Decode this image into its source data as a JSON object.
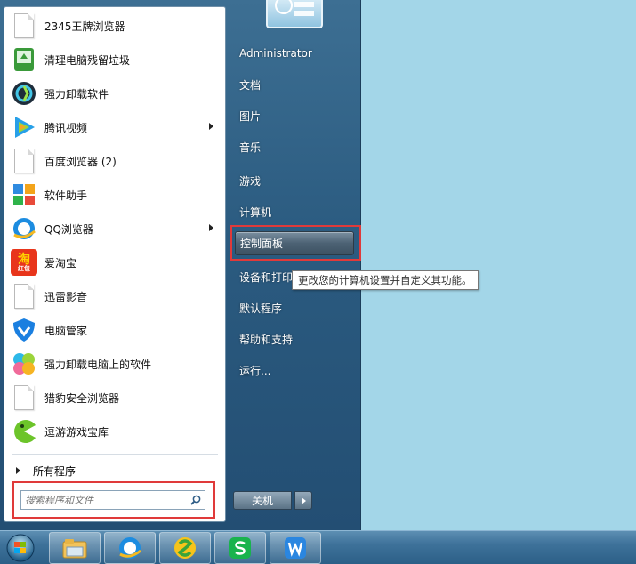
{
  "programs": [
    {
      "label": "2345王牌浏览器",
      "icon": "blank-file-icon",
      "has_submenu": false
    },
    {
      "label": "清理电脑残留垃圾",
      "icon": "recycle-bin-icon",
      "has_submenu": false
    },
    {
      "label": "强力卸载软件",
      "icon": "uninstaller-icon",
      "has_submenu": false
    },
    {
      "label": "腾讯视频",
      "icon": "tencent-video-icon",
      "has_submenu": true
    },
    {
      "label": "百度浏览器 (2)",
      "icon": "blank-file-icon",
      "has_submenu": false
    },
    {
      "label": "软件助手",
      "icon": "app-helper-icon",
      "has_submenu": false
    },
    {
      "label": "QQ浏览器",
      "icon": "qq-browser-icon",
      "has_submenu": true
    },
    {
      "label": "爱淘宝",
      "icon": "taobao-icon",
      "has_submenu": false
    },
    {
      "label": "迅雷影音",
      "icon": "blank-file-icon",
      "has_submenu": false
    },
    {
      "label": "电脑管家",
      "icon": "pc-manager-shield-icon",
      "has_submenu": false
    },
    {
      "label": "强力卸载电脑上的软件",
      "icon": "pinwheel-icon",
      "has_submenu": false
    },
    {
      "label": "猎豹安全浏览器",
      "icon": "blank-file-icon",
      "has_submenu": false
    },
    {
      "label": "逗游游戏宝库",
      "icon": "game-pacman-icon",
      "has_submenu": false
    }
  ],
  "taobao_badge": "淘",
  "taobao_sub": "红包",
  "all_programs_label": "所有程序",
  "search_placeholder": "搜索程序和文件",
  "right_links": {
    "user": "Administrator",
    "documents": "文档",
    "pictures": "图片",
    "music": "音乐",
    "games": "游戏",
    "computer": "计算机",
    "control_panel": "控制面板",
    "devices": "设备和打印",
    "default_programs": "默认程序",
    "help": "帮助和支持",
    "run": "运行..."
  },
  "tooltip": "更改您的计算机设置并自定义其功能。",
  "shutdown_label": "关机",
  "taskbar": [
    "file-explorer-icon",
    "qq-browser-icon",
    "sogou-browser-icon",
    "sheets-s-icon",
    "writer-w-icon"
  ],
  "colors": {
    "highlight_red": "#e03a3a",
    "sheet_green": "#19b34d",
    "writer_blue": "#2a86e0"
  }
}
